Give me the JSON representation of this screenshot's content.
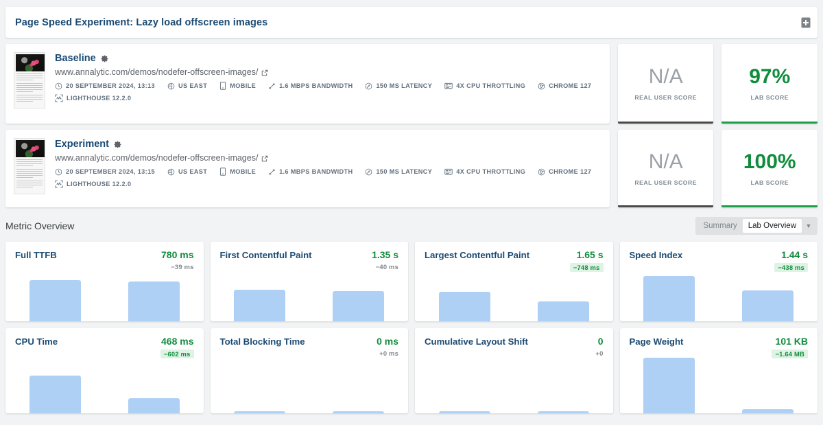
{
  "header": {
    "title": "Page Speed Experiment: Lazy load offscreen images",
    "add_button_name": "add-panel-button"
  },
  "runs": [
    {
      "name": "Baseline",
      "url": "www.annalytic.com/demos/nodefer-offscreen-images/",
      "meta_row1": [
        {
          "icon": "clock-icon",
          "label": "20 SEPTEMBER 2024, 13:13"
        },
        {
          "icon": "globe-icon",
          "label": "US EAST"
        },
        {
          "icon": "mobile-icon",
          "label": "MOBILE"
        },
        {
          "icon": "bandwidth-icon",
          "label": "1.6 MBPS BANDWIDTH"
        },
        {
          "icon": "latency-icon",
          "label": "150 MS LATENCY"
        },
        {
          "icon": "cpu-icon",
          "label": "4X CPU THROTTLING"
        },
        {
          "icon": "chrome-icon",
          "label": "CHROME 127"
        }
      ],
      "meta_row2": [
        {
          "icon": "lighthouse-icon",
          "label": "LIGHTHOUSE 12.2.0"
        }
      ],
      "real_user_score": "N/A",
      "real_user_label": "REAL USER SCORE",
      "lab_score": "97%",
      "lab_label": "LAB SCORE"
    },
    {
      "name": "Experiment",
      "url": "www.annalytic.com/demos/nodefer-offscreen-images/",
      "meta_row1": [
        {
          "icon": "clock-icon",
          "label": "20 SEPTEMBER 2024, 13:15"
        },
        {
          "icon": "globe-icon",
          "label": "US EAST"
        },
        {
          "icon": "mobile-icon",
          "label": "MOBILE"
        },
        {
          "icon": "bandwidth-icon",
          "label": "1.6 MBPS BANDWIDTH"
        },
        {
          "icon": "latency-icon",
          "label": "150 MS LATENCY"
        },
        {
          "icon": "cpu-icon",
          "label": "4X CPU THROTTLING"
        },
        {
          "icon": "chrome-icon",
          "label": "CHROME 127"
        }
      ],
      "meta_row2": [
        {
          "icon": "lighthouse-icon",
          "label": "LIGHTHOUSE 12.2.0"
        }
      ],
      "real_user_score": "N/A",
      "real_user_label": "REAL USER SCORE",
      "lab_score": "100%",
      "lab_label": "LAB SCORE"
    }
  ],
  "metric_overview": {
    "title": "Metric Overview",
    "toggle": {
      "summary_label": "Summary",
      "selected_label": "Lab Overview",
      "caret": "▼"
    }
  },
  "chart_data": {
    "type": "bar",
    "title": "Metric Overview — Lab Overview",
    "series_names": [
      "Baseline",
      "Experiment"
    ],
    "metrics": [
      {
        "name": "Full TTFB",
        "value": "780 ms",
        "delta": "−39 ms",
        "delta_highlight": false,
        "baseline_pct": 84,
        "experiment_pct": 81
      },
      {
        "name": "First Contentful Paint",
        "value": "1.35 s",
        "delta": "−40 ms",
        "delta_highlight": false,
        "baseline_pct": 64,
        "experiment_pct": 61
      },
      {
        "name": "Largest Contentful Paint",
        "value": "1.65 s",
        "delta": "−748 ms",
        "delta_highlight": true,
        "baseline_pct": 60,
        "experiment_pct": 40
      },
      {
        "name": "Speed Index",
        "value": "1.44 s",
        "delta": "−438 ms",
        "delta_highlight": true,
        "baseline_pct": 92,
        "experiment_pct": 63
      },
      {
        "name": "CPU Time",
        "value": "468 ms",
        "delta": "−602 ms",
        "delta_highlight": true,
        "baseline_pct": 66,
        "experiment_pct": 26
      },
      {
        "name": "Total Blocking Time",
        "value": "0 ms",
        "delta": "+0 ms",
        "delta_highlight": false,
        "baseline_pct": 3,
        "experiment_pct": 3
      },
      {
        "name": "Cumulative Layout Shift",
        "value": "0",
        "delta": "+0",
        "delta_highlight": false,
        "baseline_pct": 3,
        "experiment_pct": 3
      },
      {
        "name": "Page Weight",
        "value": "101 KB",
        "delta": "−1.64 MB",
        "delta_highlight": true,
        "baseline_pct": 97,
        "experiment_pct": 7
      }
    ],
    "bar_color": "#aed0f5",
    "good_color": "#0f8c3c"
  }
}
